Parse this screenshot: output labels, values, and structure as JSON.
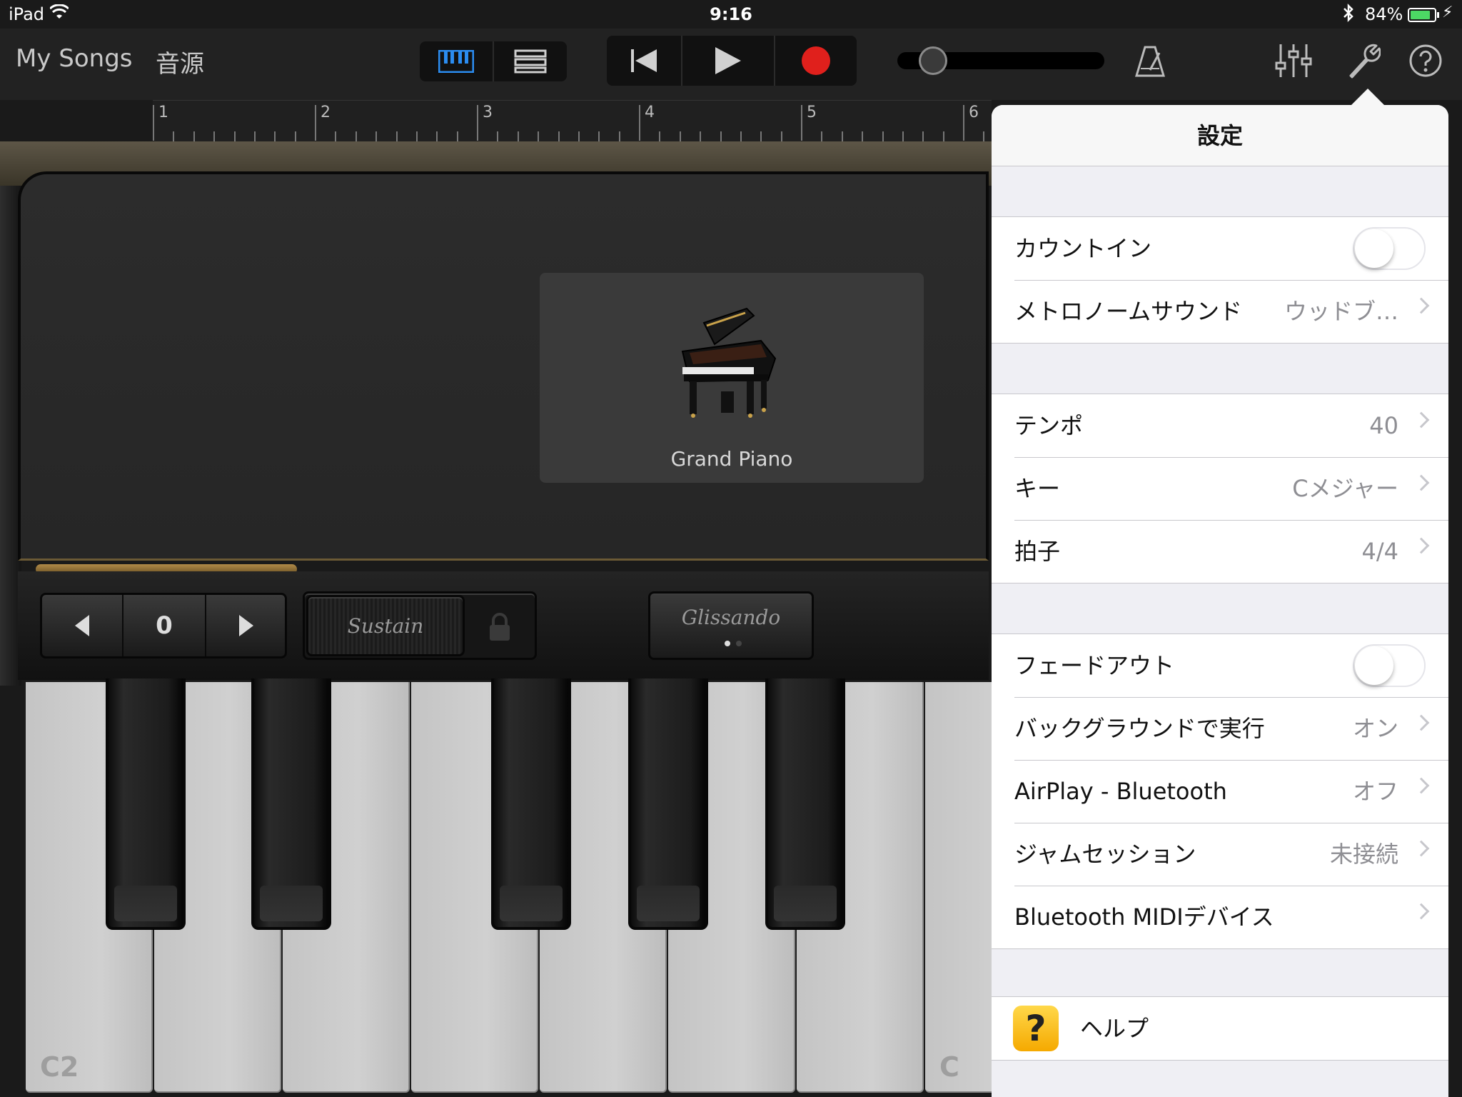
{
  "status": {
    "device": "iPad",
    "time": "9:16",
    "battery_pct": "84%",
    "battery_level": 0.84
  },
  "toolbar": {
    "my_songs": "My Songs",
    "instruments": "音源",
    "view_icons": [
      "keyboard-view-icon",
      "tracks-view-icon"
    ],
    "transport_icons": [
      "rewind-icon",
      "play-icon",
      "record-icon"
    ],
    "record_color": "#e0201c",
    "master_volume": 0.1,
    "right_icons": [
      "metronome-icon",
      "mixer-icon",
      "settings-wrench-icon",
      "help-icon"
    ]
  },
  "ruler": {
    "bars": [
      "1",
      "2",
      "3",
      "4",
      "5",
      "6"
    ]
  },
  "instrument": {
    "name": "Grand Piano",
    "icon": "grand-piano-icon"
  },
  "controls": {
    "octave_value": "0",
    "sustain_label": "Sustain",
    "glissando_label": "Glissando"
  },
  "keyboard": {
    "labels": [
      "C2",
      "C"
    ]
  },
  "settings": {
    "title": "設定",
    "group1": [
      {
        "label": "カウントイン",
        "toggle": false
      },
      {
        "label": "メトロノームサウンド",
        "value": "ウッドブ…"
      }
    ],
    "group2": [
      {
        "label": "テンポ",
        "value": "40"
      },
      {
        "label": "キー",
        "value": "Cメジャー"
      },
      {
        "label": "拍子",
        "value": "4/4"
      }
    ],
    "group3": [
      {
        "label": "フェードアウト",
        "toggle": false
      },
      {
        "label": "バックグラウンドで実行",
        "value": "オン"
      },
      {
        "label": "AirPlay - Bluetooth",
        "value": "オフ"
      },
      {
        "label": "ジャムセッション",
        "value": "未接続"
      },
      {
        "label": "Bluetooth MIDIデバイス",
        "value": ""
      }
    ],
    "help": {
      "label": "ヘルプ",
      "icon_text": "?"
    }
  }
}
